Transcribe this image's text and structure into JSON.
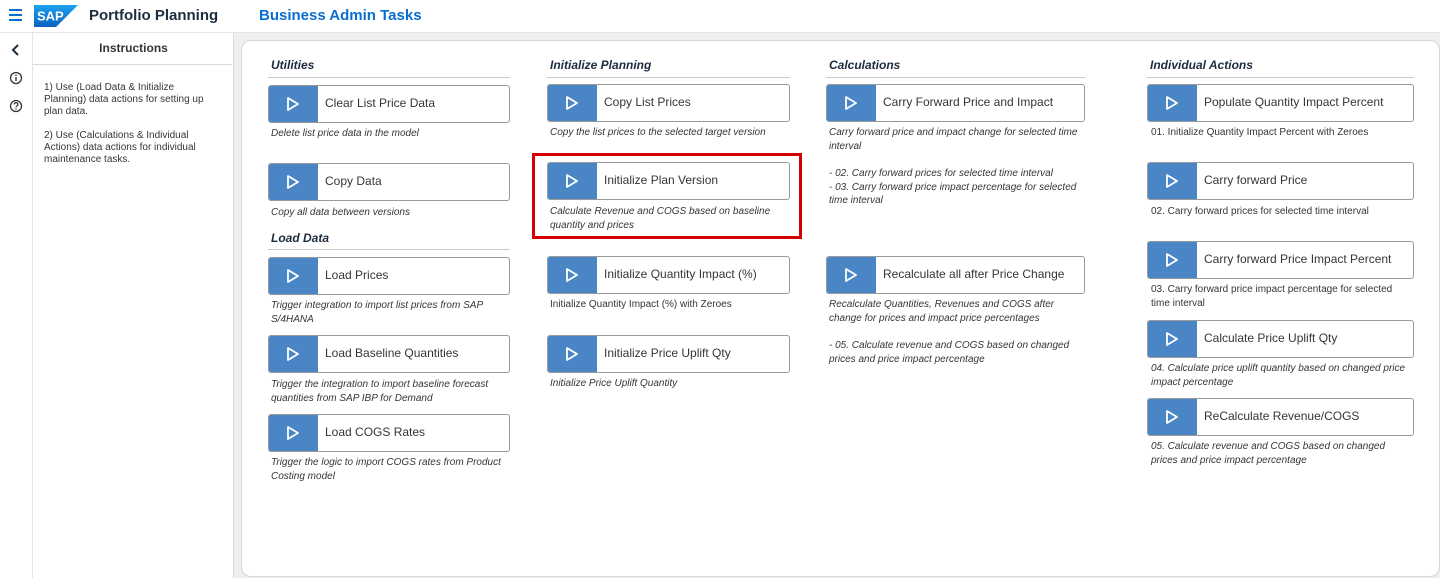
{
  "header": {
    "logo_text": "SAP",
    "app_title": "Portfolio Planning",
    "page_title": "Business Admin Tasks"
  },
  "rail": {
    "icons": [
      "back-chevron-icon",
      "info-icon",
      "help-icon"
    ]
  },
  "instructions": {
    "title": "Instructions",
    "p1": "1) Use (Load Data & Initialize Planning) data actions for setting up plan data.",
    "p2": "2) Use (Calculations & Individual Actions) data actions for individual maintenance tasks."
  },
  "sections": {
    "utilities": "Utilities",
    "load_data": "Load Data",
    "initialize_planning": "Initialize Planning",
    "calculations": "Calculations",
    "individual_actions": "Individual Actions"
  },
  "buttons": {
    "clear_list_price": {
      "label": "Clear List Price Data",
      "desc": "Delete list price data in the model"
    },
    "copy_data": {
      "label": "Copy Data",
      "desc": "Copy all data between versions"
    },
    "load_prices": {
      "label": "Load Prices",
      "desc": "Trigger integration to import list prices from SAP S/4HANA"
    },
    "load_baseline": {
      "label": "Load Baseline Quantities",
      "desc": "Trigger the integration to import baseline forecast quantities from SAP IBP for Demand"
    },
    "load_cogs": {
      "label": "Load COGS Rates",
      "desc": "Trigger the logic to import COGS rates from Product Costing model"
    },
    "copy_list_prices": {
      "label": "Copy List Prices",
      "desc": "Copy the list prices to the selected target version"
    },
    "init_plan_version": {
      "label": "Initialize Plan Version",
      "desc": "Calculate Revenue and COGS based on baseline quantity and prices"
    },
    "init_qty_impact": {
      "label": "Initialize Quantity Impact (%)",
      "desc": "Initialize Quantity Impact (%) with Zeroes"
    },
    "init_price_uplift": {
      "label": "Initialize Price Uplift Qty",
      "desc": "Initialize Price Uplift Quantity"
    },
    "carry_fwd_price_impact": {
      "label": "Carry Forward Price and Impact",
      "desc": "Carry forward price and impact change for selected time interval",
      "desc2": "- 02. Carry forward prices for selected time interval\n- 03. Carry forward price impact percentage for selected time interval"
    },
    "recalc_all": {
      "label": "Recalculate all after Price Change",
      "desc": "Recalculate Quantities, Revenues and COGS after change for prices and impact price percentages",
      "desc2": "- 05. Calculate revenue and COGS based on changed prices and price impact percentage"
    },
    "populate_qty_impact": {
      "label": "Populate Quantity Impact Percent",
      "desc": "01. Initialize Quantity Impact Percent with Zeroes"
    },
    "carry_fwd_price": {
      "label": "Carry forward Price",
      "desc": "02. Carry forward prices for selected time interval"
    },
    "carry_fwd_impact_pct": {
      "label": "Carry forward Price Impact Percent",
      "desc": "03. Carry forward price impact percentage for selected time interval"
    },
    "calc_price_uplift": {
      "label": "Calculate Price Uplift Qty",
      "desc": "04. Calculate price uplift quantity based on changed price impact percentage"
    },
    "recalc_revenue": {
      "label": "ReCalculate Revenue/COGS",
      "desc": "05. Calculate revenue and COGS based on changed prices and price impact percentage"
    }
  },
  "colors": {
    "accent": "#0a6ed1",
    "play_button": "#4a86c5",
    "highlight": "#d40000"
  }
}
